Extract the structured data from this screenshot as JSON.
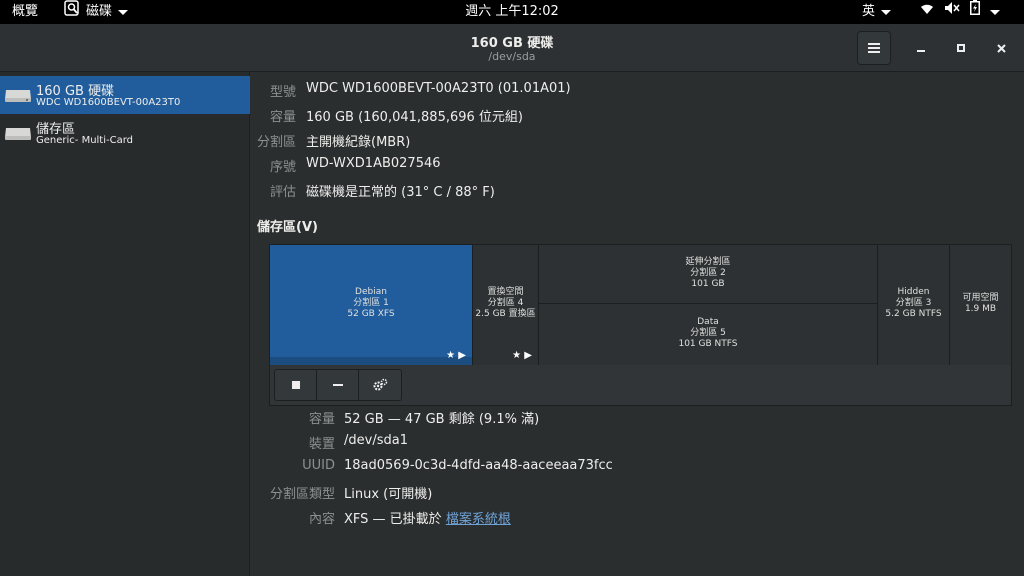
{
  "topbar": {
    "activities": "概覽",
    "app_name": "磁碟",
    "clock": "週六 上午12:02",
    "input_method": "英"
  },
  "window": {
    "title": "160 GB 硬碟",
    "subtitle": "/dev/sda"
  },
  "sidebar": {
    "drives": [
      {
        "name": "160 GB 硬碟",
        "model": "WDC WD1600BEVT-00A23T0"
      },
      {
        "name": "儲存區",
        "model": "Generic- Multi-Card"
      }
    ]
  },
  "drive_info": {
    "model_label": "型號",
    "model_value": "WDC WD1600BEVT-00A23T0 (01.01A01)",
    "size_label": "容量",
    "size_value": "160 GB (160,041,885,696 位元組)",
    "partitioning_label": "分割區",
    "partitioning_value": "主開機紀錄(MBR)",
    "serial_label": "序號",
    "serial_value": "WD-WXD1AB027546",
    "assessment_label": "評估",
    "assessment_value": "磁碟機是正常的 (31° C / 88° F)"
  },
  "volumes": {
    "heading": "儲存區(V)",
    "segments": {
      "debian": [
        "Debian",
        "分割區 1",
        "52 GB XFS"
      ],
      "swap": [
        "置換空間",
        "分割區 4",
        "2.5 GB 置換區"
      ],
      "extended": [
        "延伸分割區",
        "分割區 2",
        "101 GB"
      ],
      "data": [
        "Data",
        "分割區 5",
        "101 GB NTFS"
      ],
      "hidden": [
        "Hidden",
        "分割區 3",
        "5.2 GB NTFS"
      ],
      "free": [
        "可用空間",
        "1.9 MB"
      ]
    },
    "icon_star": "★",
    "icon_play": "▶"
  },
  "partition_info": {
    "size_label": "容量",
    "size_value": "52 GB — 47 GB 剩餘 (9.1% 滿)",
    "device_label": "裝置",
    "device_value": "/dev/sda1",
    "uuid_label": "UUID",
    "uuid_value": "18ad0569-0c3d-4dfd-aa48-aaceeaa73fcc",
    "type_label": "分割區類型",
    "type_value": "Linux (可開機)",
    "contents_label": "內容",
    "contents_value": "XFS — 已掛載於 ",
    "contents_link": "檔案系統根"
  },
  "colors": {
    "accent": "#215d9c",
    "background": "#2b2e2f",
    "link": "#6fa3d8"
  }
}
